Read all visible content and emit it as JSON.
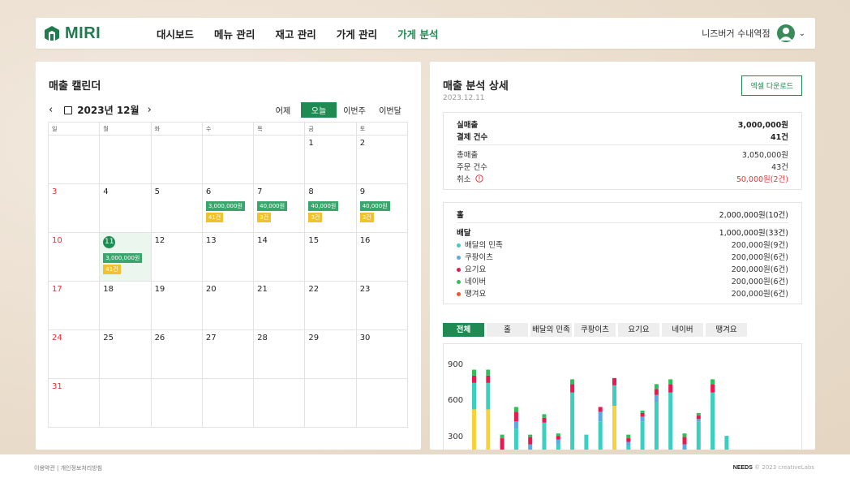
{
  "header": {
    "logo": "MIRI",
    "nav": [
      "대시보드",
      "메뉴 관리",
      "재고 관리",
      "가게 관리",
      "가게 분석"
    ],
    "active_nav": 4,
    "user_name": "니즈버거 수내역점"
  },
  "calendar": {
    "title": "매출 캘린더",
    "month": "2023년 12월",
    "quick": [
      "어제",
      "오늘",
      "이번주",
      "이번달"
    ],
    "active_quick": 1,
    "weekdays": [
      "일",
      "월",
      "화",
      "수",
      "목",
      "금",
      "토"
    ],
    "weeks": [
      [
        {
          "d": ""
        },
        {
          "d": ""
        },
        {
          "d": ""
        },
        {
          "d": ""
        },
        {
          "d": ""
        },
        {
          "d": "1"
        },
        {
          "d": "2"
        }
      ],
      [
        {
          "d": "3"
        },
        {
          "d": "4"
        },
        {
          "d": "5"
        },
        {
          "d": "6",
          "sales": "3,000,000원",
          "count": "41건"
        },
        {
          "d": "7",
          "sales": "40,000원",
          "count": "3건"
        },
        {
          "d": "8",
          "sales": "40,000원",
          "count": "3건"
        },
        {
          "d": "9",
          "sales": "40,000원",
          "count": "3건"
        }
      ],
      [
        {
          "d": "10"
        },
        {
          "d": "11",
          "sales": "3,000,000원",
          "count": "41건",
          "today": true
        },
        {
          "d": "12"
        },
        {
          "d": "13"
        },
        {
          "d": "14"
        },
        {
          "d": "15"
        },
        {
          "d": "16"
        }
      ],
      [
        {
          "d": "17"
        },
        {
          "d": "18"
        },
        {
          "d": "19"
        },
        {
          "d": "20"
        },
        {
          "d": "21"
        },
        {
          "d": "22"
        },
        {
          "d": "23"
        }
      ],
      [
        {
          "d": "24"
        },
        {
          "d": "25"
        },
        {
          "d": "26"
        },
        {
          "d": "27"
        },
        {
          "d": "28"
        },
        {
          "d": "29"
        },
        {
          "d": "30"
        }
      ],
      [
        {
          "d": "31"
        },
        {
          "d": ""
        },
        {
          "d": ""
        },
        {
          "d": ""
        },
        {
          "d": ""
        },
        {
          "d": ""
        },
        {
          "d": ""
        }
      ]
    ]
  },
  "analysis": {
    "title": "매출 분석 상세",
    "date": "2023.12.11",
    "download": "엑셀 다운로드",
    "summary": {
      "net_label": "실매출",
      "net": "3,000,000원",
      "pay_label": "결제 건수",
      "pay": "41건",
      "gross_label": "총매출",
      "gross": "3,050,000원",
      "orders_label": "주문 건수",
      "orders": "43건",
      "cancel_label": "취소",
      "cancel": "50,000원(2건)"
    },
    "channels": {
      "hall_label": "홀",
      "hall": "2,000,000원(10건)",
      "delivery_label": "배달",
      "delivery": "1,000,000원(33건)",
      "items": [
        {
          "name": "배달의 민족",
          "value": "200,000원(9건)",
          "color": "#3ccfc0"
        },
        {
          "name": "쿠팡이츠",
          "value": "200,000원(6건)",
          "color": "#5ba8e8"
        },
        {
          "name": "요기요",
          "value": "200,000원(6건)",
          "color": "#e8194f"
        },
        {
          "name": "네이버",
          "value": "200,000원(6건)",
          "color": "#2fbf5a"
        },
        {
          "name": "땡겨요",
          "value": "200,000원(6건)",
          "color": "#f2552c"
        }
      ]
    },
    "tabs": [
      "전체",
      "홀",
      "배달의 민족",
      "쿠팡이츠",
      "요기요",
      "네이버",
      "땡겨요"
    ],
    "active_tab": 0
  },
  "chart_data": {
    "type": "bar",
    "stacked": true,
    "yticks": [
      900,
      600,
      300
    ],
    "series_colors": {
      "yellow": "#f7d23a",
      "teal": "#3ccfc0",
      "blue": "#5ba8e8",
      "pink": "#e8194f",
      "green": "#2fbf5a"
    },
    "bars": [
      {
        "yellow": 570,
        "teal": 220,
        "blue": 0,
        "pink": 60,
        "green": 50
      },
      {
        "yellow": 570,
        "teal": 220,
        "blue": 0,
        "pink": 60,
        "green": 50
      },
      {
        "yellow": 0,
        "teal": 0,
        "blue": 230,
        "pink": 100,
        "green": 30
      },
      {
        "yellow": 170,
        "teal": 240,
        "blue": 60,
        "pink": 80,
        "green": 40
      },
      {
        "yellow": 0,
        "teal": 0,
        "blue": 280,
        "pink": 60,
        "green": 20
      },
      {
        "yellow": 0,
        "teal": 460,
        "blue": 0,
        "pink": 40,
        "green": 30
      },
      {
        "yellow": 0,
        "teal": 280,
        "blue": 40,
        "pink": 30,
        "green": 20
      },
      {
        "yellow": 190,
        "teal": 520,
        "blue": 0,
        "pink": 70,
        "green": 40
      },
      {
        "yellow": 0,
        "teal": 360,
        "blue": 0,
        "pink": 0,
        "green": 0
      },
      {
        "yellow": 0,
        "teal": 470,
        "blue": 80,
        "pink": 40,
        "green": 0
      },
      {
        "yellow": 600,
        "teal": 170,
        "blue": 0,
        "pink": 60,
        "green": 0
      },
      {
        "yellow": 0,
        "teal": 270,
        "blue": 30,
        "pink": 30,
        "green": 30
      },
      {
        "yellow": 0,
        "teal": 470,
        "blue": 40,
        "pink": 30,
        "green": 20
      },
      {
        "yellow": 160,
        "teal": 470,
        "blue": 60,
        "pink": 50,
        "green": 40
      },
      {
        "yellow": 190,
        "teal": 520,
        "blue": 0,
        "pink": 70,
        "green": 40
      },
      {
        "yellow": 0,
        "teal": 240,
        "blue": 40,
        "pink": 60,
        "green": 30
      },
      {
        "yellow": 0,
        "teal": 470,
        "blue": 20,
        "pink": 30,
        "green": 20
      },
      {
        "yellow": 190,
        "teal": 520,
        "blue": 0,
        "pink": 70,
        "green": 40
      },
      {
        "yellow": 150,
        "teal": 200,
        "blue": 0,
        "pink": 0,
        "green": 0
      }
    ]
  },
  "footer": {
    "links": "이용약관  |  개인정보처리방침",
    "brand": "NEEDS",
    "copyright": "© 2023 creativeLabs"
  }
}
